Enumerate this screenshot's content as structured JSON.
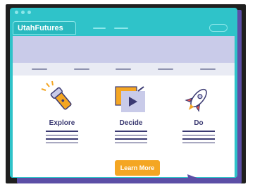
{
  "app": {
    "brand": "UtahFutures"
  },
  "features": [
    {
      "label": "Explore",
      "icon": "flashlight-icon"
    },
    {
      "label": "Decide",
      "icon": "video-play-icon"
    },
    {
      "label": "Do",
      "icon": "rocket-icon"
    }
  ],
  "cta": {
    "label": "Learn More"
  },
  "colors": {
    "window": "#2fc3c9",
    "shadow": "#5c4fa6",
    "banner": "#c9cbe9",
    "text": "#3b3a72",
    "button": "#f4a623"
  }
}
